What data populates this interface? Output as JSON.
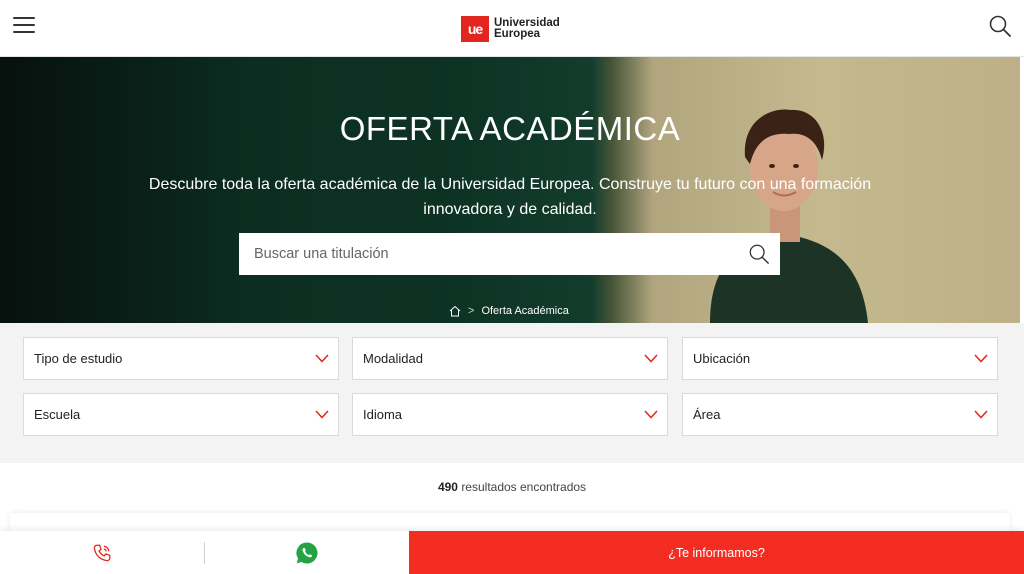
{
  "header": {
    "logo_mark": "ue",
    "logo_line1": "Universidad",
    "logo_line2": "Europea"
  },
  "hero": {
    "title": "OFERTA ACADÉMICA",
    "subtitle": "Descubre toda la oferta académica de la Universidad Europea. Construye tu futuro con una formación innovadora y de calidad.",
    "search_placeholder": "Buscar una titulación",
    "breadcrumb": {
      "current": "Oferta Académica"
    }
  },
  "filters": [
    {
      "label": "Tipo de estudio"
    },
    {
      "label": "Modalidad"
    },
    {
      "label": "Ubicación"
    },
    {
      "label": "Escuela"
    },
    {
      "label": "Idioma"
    },
    {
      "label": "Área"
    }
  ],
  "results": {
    "count": "490",
    "label": "resultados encontrados"
  },
  "bottombar": {
    "cta_label": "¿Te informamos?"
  },
  "colors": {
    "brand_red": "#e3261d",
    "cta_red": "#f32d21",
    "whatsapp_green": "#25a244"
  }
}
